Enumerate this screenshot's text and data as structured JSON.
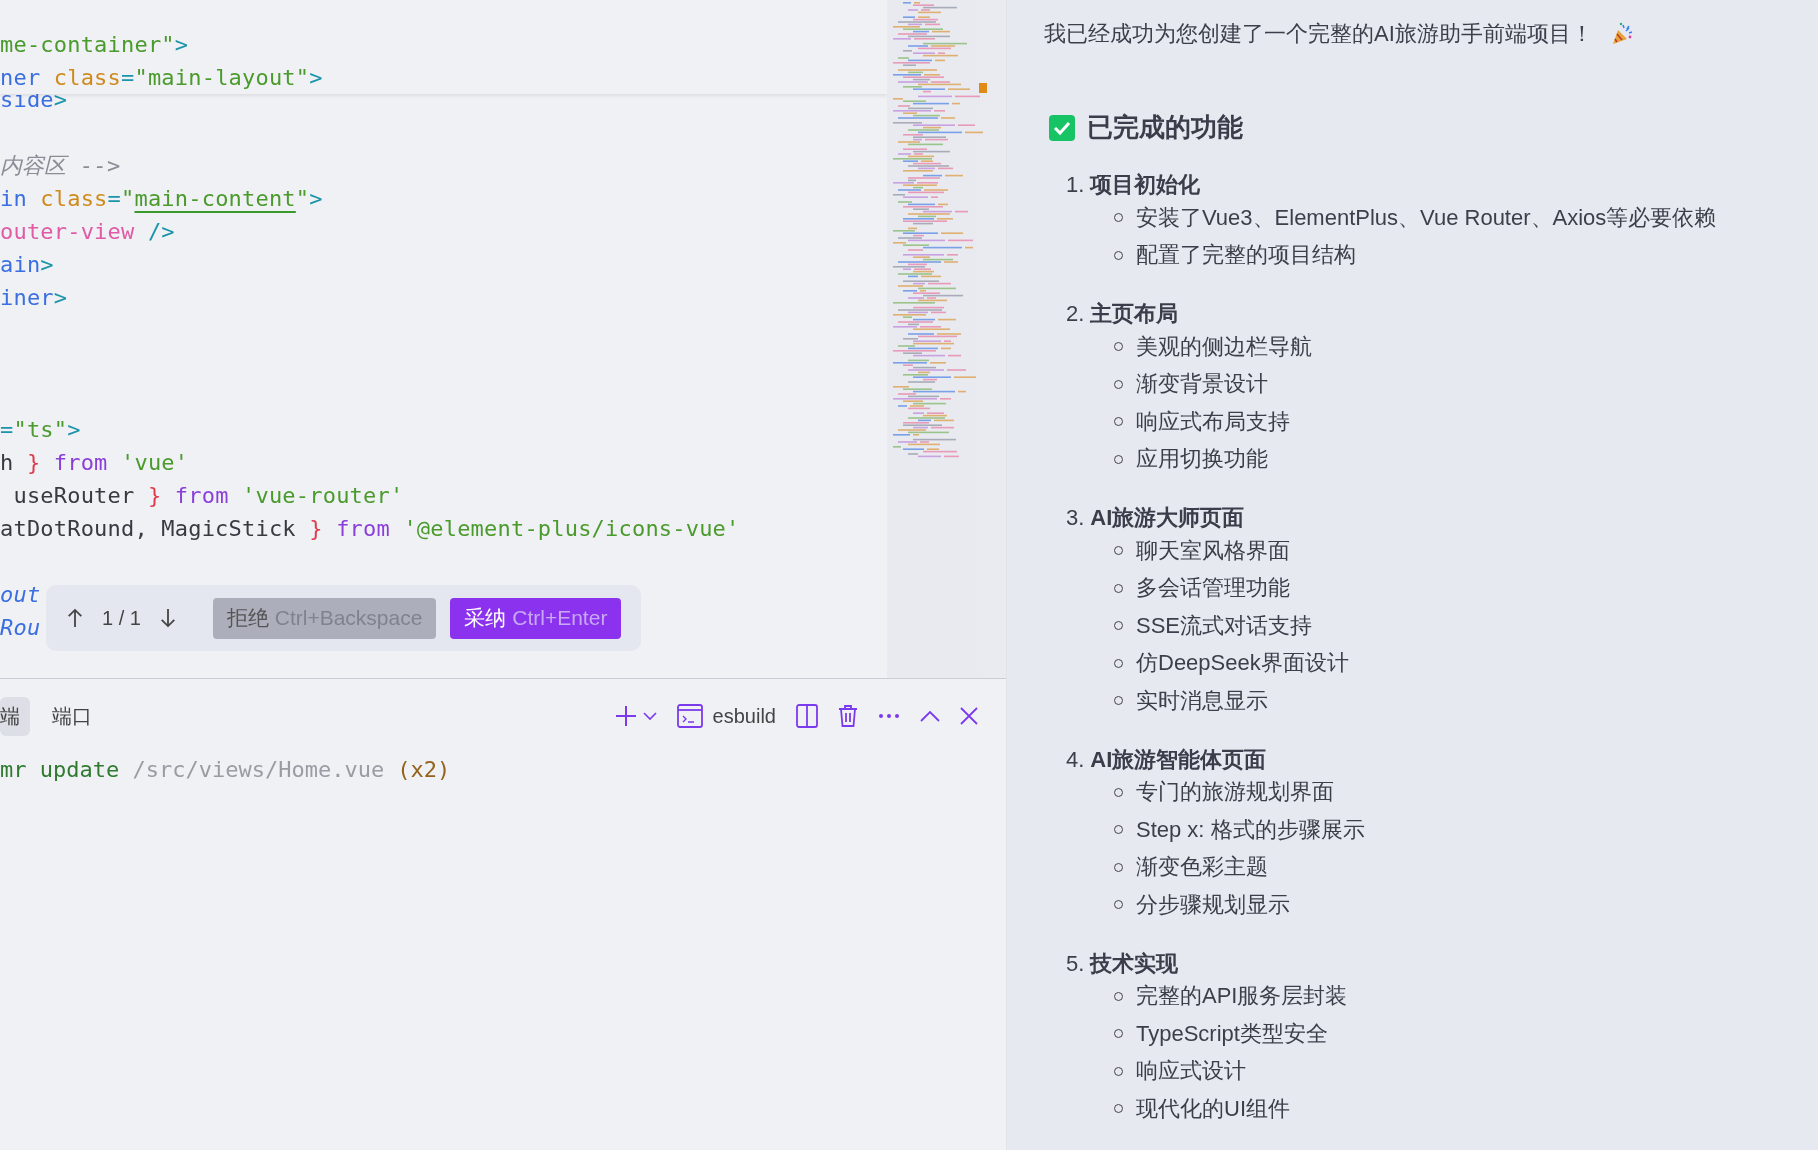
{
  "editor": {
    "sticky_lines": [
      [
        {
          "text": "me-container\"",
          "kind": "string"
        },
        {
          "text": ">",
          "kind": "punct"
        }
      ],
      [
        {
          "text": "ner",
          "kind": "tag"
        },
        {
          "text": " class",
          "kind": "attr"
        },
        {
          "text": "=",
          "kind": "punct"
        },
        {
          "text": "\"main-layout\"",
          "kind": "string"
        },
        {
          "text": ">",
          "kind": "punct"
        }
      ]
    ],
    "lines": [
      {
        "kind": "code",
        "tokens": [
          {
            "text": "side",
            "kind": "tag"
          },
          {
            "text": ">",
            "kind": "punct"
          }
        ]
      },
      {
        "kind": "blank"
      },
      {
        "kind": "code",
        "tokens": [
          {
            "text": "内容区 -->",
            "kind": "comment"
          }
        ]
      },
      {
        "kind": "code",
        "tokens": [
          {
            "text": "in",
            "kind": "tag"
          },
          {
            "text": " class",
            "kind": "attr"
          },
          {
            "text": "=",
            "kind": "punct"
          },
          {
            "text": "\"",
            "kind": "string"
          },
          {
            "text": "main-content",
            "kind": "string-underlined"
          },
          {
            "text": "\"",
            "kind": "string"
          },
          {
            "text": ">",
            "kind": "punct"
          }
        ]
      },
      {
        "kind": "code",
        "tokens": [
          {
            "text": "outer-view",
            "kind": "component"
          },
          {
            "text": " />",
            "kind": "punct"
          }
        ]
      },
      {
        "kind": "code",
        "tokens": [
          {
            "text": "ain",
            "kind": "tag"
          },
          {
            "text": ">",
            "kind": "punct"
          }
        ]
      },
      {
        "kind": "code",
        "tokens": [
          {
            "text": "iner",
            "kind": "tag"
          },
          {
            "text": ">",
            "kind": "punct"
          }
        ]
      },
      {
        "kind": "blank"
      },
      {
        "kind": "blank"
      },
      {
        "kind": "blank"
      },
      {
        "kind": "code",
        "tokens": [
          {
            "text": "=",
            "kind": "punct"
          },
          {
            "text": "\"ts\"",
            "kind": "string"
          },
          {
            "text": ">",
            "kind": "punct"
          }
        ]
      },
      {
        "kind": "code",
        "tokens": [
          {
            "text": "h ",
            "kind": "plain"
          },
          {
            "text": "}",
            "kind": "brace"
          },
          {
            "text": " from",
            "kind": "keyword"
          },
          {
            "text": " 'vue'",
            "kind": "string"
          }
        ]
      },
      {
        "kind": "code",
        "tokens": [
          {
            "text": " useRouter ",
            "kind": "plain"
          },
          {
            "text": "}",
            "kind": "brace"
          },
          {
            "text": " from",
            "kind": "keyword"
          },
          {
            "text": " 'vue-router'",
            "kind": "string"
          }
        ]
      },
      {
        "kind": "code",
        "tokens": [
          {
            "text": "atDotRound, MagicStick ",
            "kind": "plain"
          },
          {
            "text": "}",
            "kind": "brace"
          },
          {
            "text": " from",
            "kind": "keyword"
          },
          {
            "text": " '@element-plus/icons-vue'",
            "kind": "string"
          }
        ]
      },
      {
        "kind": "blank"
      },
      {
        "kind": "code",
        "tokens": [
          {
            "text": "out",
            "kind": "variable"
          }
        ]
      },
      {
        "kind": "code",
        "tokens": [
          {
            "text": "Rou",
            "kind": "variable"
          }
        ]
      }
    ]
  },
  "review_bar": {
    "counter": "1 / 1",
    "reject": {
      "label": "拒绝",
      "shortcut": "Ctrl+Backspace"
    },
    "accept": {
      "label": "采纳",
      "shortcut": "Ctrl+Enter"
    }
  },
  "terminal": {
    "tabs": [
      {
        "label": "端",
        "selected": true
      },
      {
        "label": "端口",
        "selected": false
      }
    ],
    "shell_label": "esbuild",
    "output": [
      {
        "text": "mr update",
        "kind": "info"
      },
      {
        "text": " /src/views/Home.vue",
        "kind": "path"
      },
      {
        "text": " (x2)",
        "kind": "count"
      }
    ]
  },
  "chat": {
    "intro": "我已经成功为您创建了一个完整的AI旅游助手前端项目！",
    "heading": "已完成的功能",
    "sections": [
      {
        "number": "1.",
        "title": "项目初始化",
        "items": [
          "安装了Vue3、ElementPlus、Vue Router、Axios等必要依赖",
          "配置了完整的项目结构"
        ]
      },
      {
        "number": "2.",
        "title": "主页布局",
        "items": [
          "美观的侧边栏导航",
          "渐变背景设计",
          "响应式布局支持",
          "应用切换功能"
        ]
      },
      {
        "number": "3.",
        "title": "AI旅游大师页面",
        "items": [
          "聊天室风格界面",
          "多会话管理功能",
          "SSE流式对话支持",
          "仿DeepSeek界面设计",
          "实时消息显示"
        ]
      },
      {
        "number": "4.",
        "title": "AI旅游智能体页面",
        "items": [
          "专门的旅游规划界面",
          "Step x: 格式的步骤展示",
          "渐变色彩主题",
          "分步骤规划显示"
        ]
      },
      {
        "number": "5.",
        "title": "技术实现",
        "items": [
          "完整的API服务层封装",
          "TypeScript类型安全",
          "响应式设计",
          "现代化的UI组件"
        ]
      }
    ]
  }
}
